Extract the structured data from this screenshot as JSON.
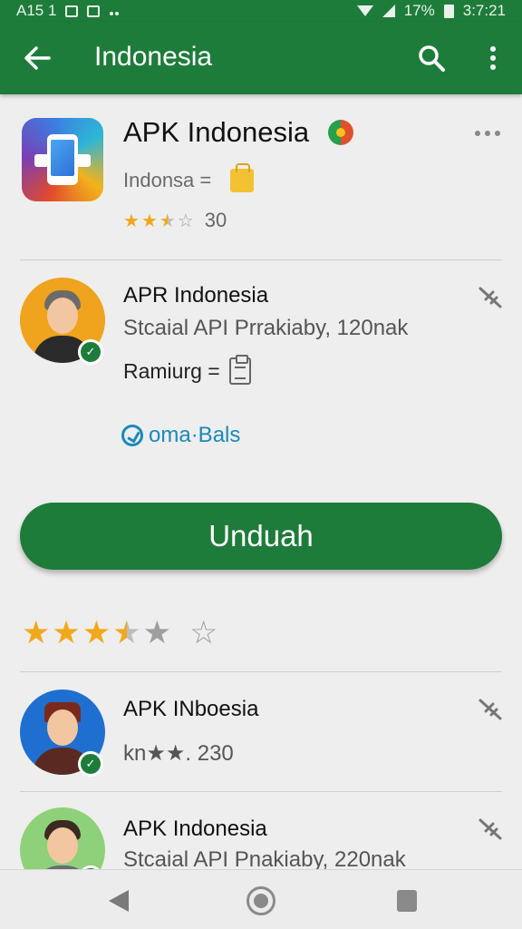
{
  "status_bar": {
    "left_text": "A15 1",
    "time": "3:7:21",
    "battery": "17%"
  },
  "app_bar": {
    "title": "Indonesia",
    "icons": [
      "back-arrow-icon",
      "search-icon",
      "more-vert-icon"
    ]
  },
  "featured": {
    "title": "APK Indonesia",
    "subtitle": "Indonsa =",
    "rating_text": "30",
    "rating_stars": 2.5,
    "icon": "phone-app-icon",
    "accent": "#1e7c3a"
  },
  "list": [
    {
      "title": "APR Indonesia",
      "subtitle": "Stcaial API Prrakiaby, 120nak",
      "label": "Ramiurg =",
      "link": "oma·Bals",
      "avatar_bg": "#f0a31c"
    },
    {
      "title": "APK INboesia",
      "subtitle": "kn★★. 230",
      "avatar_bg": "#1f6fd0"
    },
    {
      "title": "APK Indonesia",
      "subtitle": "Stcaial API Pnakiaby, 220nak",
      "avatar_bg": "#8fd17a"
    }
  ],
  "download_button": "Unduah",
  "overall_rating": 3.5,
  "colors": {
    "primary": "#1e7c3a",
    "star": "#f1a81c",
    "link": "#1a8ab8"
  }
}
